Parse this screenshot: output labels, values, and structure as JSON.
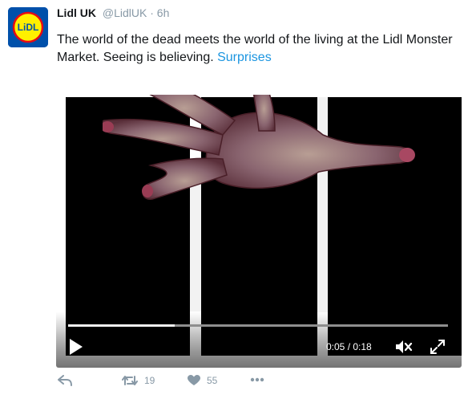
{
  "tweet": {
    "author_name": "Lidl UK",
    "author_handle": "@LidlUK",
    "separator": "·",
    "time": "6h",
    "text_main": "The world of the dead meets the world of the living at the Lidl Monster Market. Seeing is believing. ",
    "hashtag": "Surprises",
    "avatar_logo_text": "LiDL"
  },
  "video": {
    "current_time": "0:05",
    "duration": "0:18",
    "time_display": "0:05 / 0:18",
    "progress_fraction": 0.28
  },
  "actions": {
    "retweet_count": "19",
    "like_count": "55"
  },
  "colors": {
    "brand_blue": "#0050aa",
    "brand_yellow": "#fff000",
    "brand_red": "#e60a14",
    "link": "#1b95e0",
    "meta_gray": "#8899a6"
  },
  "icons": [
    "reply-icon",
    "retweet-icon",
    "like-icon",
    "more-icon",
    "play-icon",
    "mute-icon",
    "fullscreen-icon"
  ]
}
